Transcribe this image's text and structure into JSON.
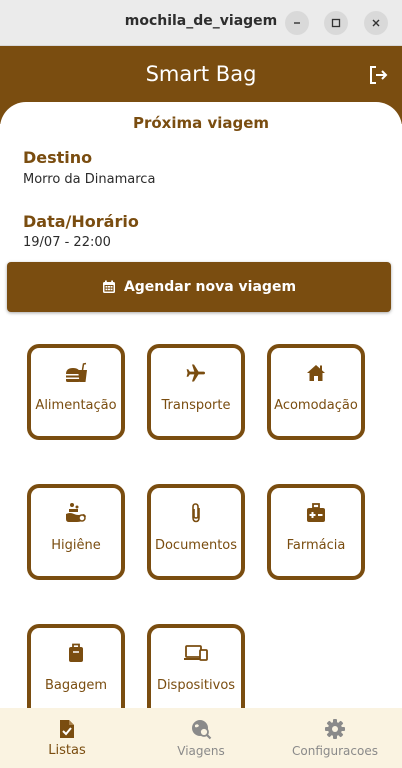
{
  "window": {
    "title": "mochila_de_viagem"
  },
  "app": {
    "title": "Smart Bag"
  },
  "trip": {
    "section_title": "Próxima viagem",
    "destination_label": "Destino",
    "destination_value": "Morro da Dinamarca",
    "datetime_label": "Data/Horário",
    "datetime_value": "19/07 - 22:00",
    "schedule_button": "Agendar nova viagem"
  },
  "categories": [
    {
      "label": "Alimentação",
      "icon": "burger-soda-icon"
    },
    {
      "label": "Transporte",
      "icon": "airplane-icon"
    },
    {
      "label": "Acomodação",
      "icon": "house-icon"
    },
    {
      "label": "Higiêne",
      "icon": "soap-icon"
    },
    {
      "label": "Documentos",
      "icon": "paperclip-icon"
    },
    {
      "label": "Farmácia",
      "icon": "medkit-icon"
    },
    {
      "label": "Bagagem",
      "icon": "suitcase-icon"
    },
    {
      "label": "Dispositivos",
      "icon": "devices-icon"
    }
  ],
  "nav": {
    "items": [
      {
        "label": "Listas",
        "icon": "checklist-icon",
        "active": true
      },
      {
        "label": "Viagens",
        "icon": "globe-search-icon",
        "active": false
      },
      {
        "label": "Configuracoes",
        "icon": "gear-icon",
        "active": false
      }
    ]
  },
  "colors": {
    "brand": "#7a4d10",
    "nav_background": "#faf3e1",
    "titlebar": "#ebebeb"
  }
}
